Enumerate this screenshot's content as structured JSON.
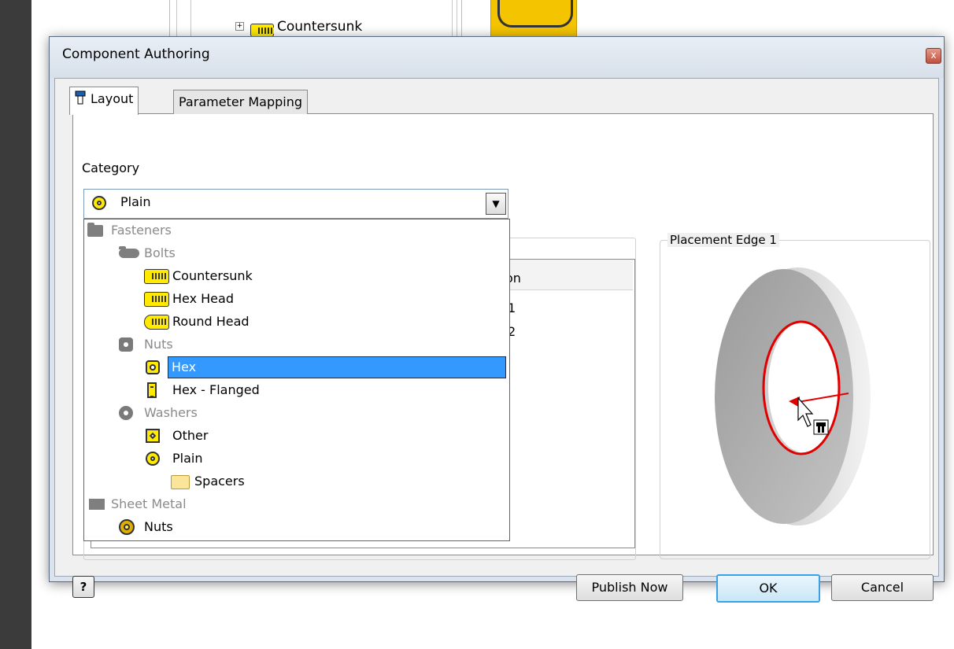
{
  "background": {
    "tree_item_label": "Countersunk",
    "tree_expander": "+"
  },
  "dialog": {
    "title": "Component Authoring",
    "close_glyph": "x"
  },
  "tabs": [
    {
      "label": "Layout",
      "icon": "bolt-small-icon",
      "active": true
    },
    {
      "label": "Parameter Mapping",
      "active": false
    }
  ],
  "category": {
    "label": "Category",
    "selected": "Plain",
    "selected_icon": "plain-washer-icon"
  },
  "dropdown": {
    "items": [
      {
        "label": "Fasteners",
        "icon": "folder-dark-icon",
        "enabled": false
      },
      {
        "label": "Bolts",
        "icon": "bolt-grey-icon",
        "enabled": false
      },
      {
        "label": "Countersunk",
        "icon": "countersunk-bolt-icon",
        "enabled": true
      },
      {
        "label": "Hex Head",
        "icon": "hex-head-bolt-icon",
        "enabled": true
      },
      {
        "label": "Round Head",
        "icon": "round-head-bolt-icon",
        "enabled": true
      },
      {
        "label": "Nuts",
        "icon": "nut-grey-icon",
        "enabled": false
      },
      {
        "label": "Hex",
        "icon": "hex-nut-icon",
        "enabled": true,
        "selected": true
      },
      {
        "label": "Hex - Flanged",
        "icon": "flanged-nut-icon",
        "enabled": true
      },
      {
        "label": "Washers",
        "icon": "washer-grey-icon",
        "enabled": false
      },
      {
        "label": "Other",
        "icon": "square-washer-icon",
        "enabled": true
      },
      {
        "label": "Plain",
        "icon": "plain-washer-icon",
        "enabled": true
      },
      {
        "label": "Spacers",
        "icon": "folder-open-icon",
        "enabled": true
      },
      {
        "label": "Sheet Metal",
        "icon": "sheet-metal-icon",
        "enabled": false
      },
      {
        "label": "Nuts",
        "icon": "gold-nut-icon",
        "enabled": true
      }
    ]
  },
  "table": {
    "column_header_fragment": "on",
    "cells": [
      "1",
      "2"
    ]
  },
  "preview": {
    "title": "Placement Edge 1"
  },
  "buttons": {
    "help": "?",
    "publish": "Publish Now",
    "ok": "OK",
    "cancel": "Cancel"
  },
  "colors": {
    "selection": "#3399ff",
    "accent_yellow": "#ffea00",
    "edge_highlight": "#e00000"
  }
}
